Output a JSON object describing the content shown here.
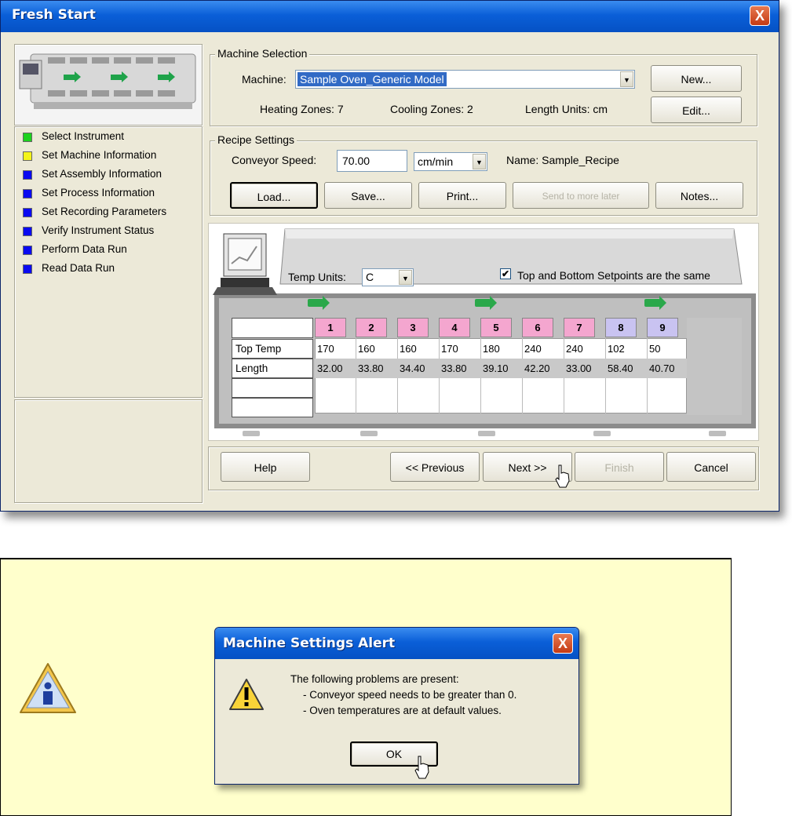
{
  "window": {
    "title": "Fresh Start",
    "close": "X"
  },
  "steps": [
    {
      "label": "Select Instrument",
      "color": "#1dd21d"
    },
    {
      "label": "Set Machine Information",
      "color": "#f4f41a"
    },
    {
      "label": "Set Assembly Information",
      "color": "#0a0af0"
    },
    {
      "label": "Set Process Information",
      "color": "#0a0af0"
    },
    {
      "label": "Set Recording Parameters",
      "color": "#0a0af0"
    },
    {
      "label": "Verify Instrument Status",
      "color": "#0a0af0"
    },
    {
      "label": "Perform Data Run",
      "color": "#0a0af0"
    },
    {
      "label": "Read Data Run",
      "color": "#0a0af0"
    }
  ],
  "machine": {
    "group_label": "Machine Selection",
    "machine_label": "Machine:",
    "machine_value": "Sample Oven_Generic Model",
    "new_button": "New...",
    "edit_button": "Edit...",
    "heating_zones": "Heating Zones: 7",
    "cooling_zones": "Cooling Zones: 2",
    "length_units": "Length Units: cm"
  },
  "recipe": {
    "group_label": "Recipe Settings",
    "speed_label": "Conveyor Speed:",
    "speed_value": "70.00",
    "speed_units": "cm/min",
    "name": "Name: Sample_Recipe",
    "buttons": {
      "load": "Load...",
      "save": "Save...",
      "print": "Print...",
      "disabled": "Send to more later",
      "notes": "Notes..."
    }
  },
  "oven": {
    "temp_units_label": "Temp Units:",
    "temp_units_value": "C",
    "same_checkbox_label": "Top and Bottom Setpoints are the same",
    "same_checked": true,
    "zones": [
      "1",
      "2",
      "3",
      "4",
      "5",
      "6",
      "7",
      "8",
      "9"
    ],
    "rows": [
      {
        "label": "Top Temp",
        "values": [
          "170",
          "160",
          "160",
          "170",
          "180",
          "240",
          "240",
          "102",
          "50"
        ]
      },
      {
        "label": "Length",
        "values": [
          "32.00",
          "33.80",
          "34.40",
          "33.80",
          "39.10",
          "42.20",
          "33.00",
          "58.40",
          "40.70"
        ]
      },
      {
        "label": "",
        "values": []
      },
      {
        "label": "",
        "values": []
      }
    ]
  },
  "nav": {
    "help": "Help",
    "previous": "<< Previous",
    "next": "Next >>",
    "finish": "Finish",
    "cancel": "Cancel"
  },
  "alert": {
    "title": "Machine Settings Alert",
    "close": "X",
    "line1": "The following problems are present:",
    "line2": "- Conveyor speed needs to be greater than 0.",
    "line3": "- Oven temperatures are at default values.",
    "ok": "OK"
  }
}
